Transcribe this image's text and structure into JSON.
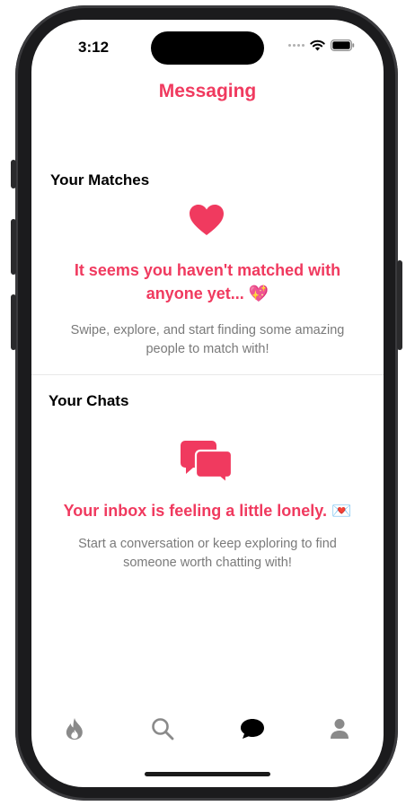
{
  "status_bar": {
    "time": "3:12"
  },
  "header": {
    "title": "Messaging"
  },
  "matches": {
    "section_title": "Your Matches",
    "icon": "heart-icon",
    "headline": "It seems you haven't matched with anyone yet... 💖",
    "subtext": "Swipe, explore, and start finding some amazing people to match with!"
  },
  "chats": {
    "section_title": "Your Chats",
    "icon": "chat-bubbles-icon",
    "headline": "Your inbox is feeling a little lonely. 💌",
    "subtext": "Start a conversation or keep exploring to find someone worth chatting with!"
  },
  "tab_bar": {
    "tabs": [
      {
        "name": "discover",
        "icon": "flame-icon",
        "active": false
      },
      {
        "name": "search",
        "icon": "search-icon",
        "active": false
      },
      {
        "name": "messages",
        "icon": "chat-icon",
        "active": true
      },
      {
        "name": "profile",
        "icon": "person-icon",
        "active": false
      }
    ]
  },
  "colors": {
    "accent": "#f03a5f",
    "muted": "#7a7a7a",
    "inactive_icon": "#8a8a8a",
    "active_icon": "#000000"
  }
}
